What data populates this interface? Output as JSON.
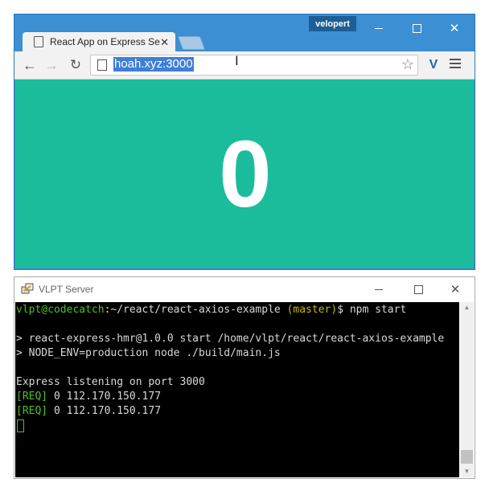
{
  "browser": {
    "user_badge": "velopert",
    "tab_title": "React App on Express Se",
    "url": "hoah.xyz:3000",
    "counter_value": "0",
    "colors": {
      "frame": "#3c8fd2",
      "content": "#1bbc9b"
    },
    "icons": {
      "tab": "page-icon",
      "back": "back-arrow-icon",
      "forward": "forward-arrow-icon",
      "reload": "reload-icon",
      "bookmark": "star-icon",
      "extension": "vue-devtools-icon",
      "menu": "hamburger-menu-icon"
    }
  },
  "terminal": {
    "title": "VLPT Server",
    "prompt_user": "vlpt@codecatch",
    "prompt_path": ":~/react/react-axios-example ",
    "prompt_branch": "(master)",
    "prompt_cmd": "$ npm start",
    "lines": [
      "> react-express-hmr@1.0.0 start /home/vlpt/react/react-axios-example",
      "> NODE_ENV=production node ./build/main.js",
      "Express listening on port 3000"
    ],
    "req_tag": "[REQ]",
    "req_lines": [
      " 0 112.170.150.177",
      " 0 112.170.150.177"
    ],
    "colors": {
      "prompt": "#4fbf26",
      "branch": "#c8b400",
      "bg": "#000000"
    }
  }
}
